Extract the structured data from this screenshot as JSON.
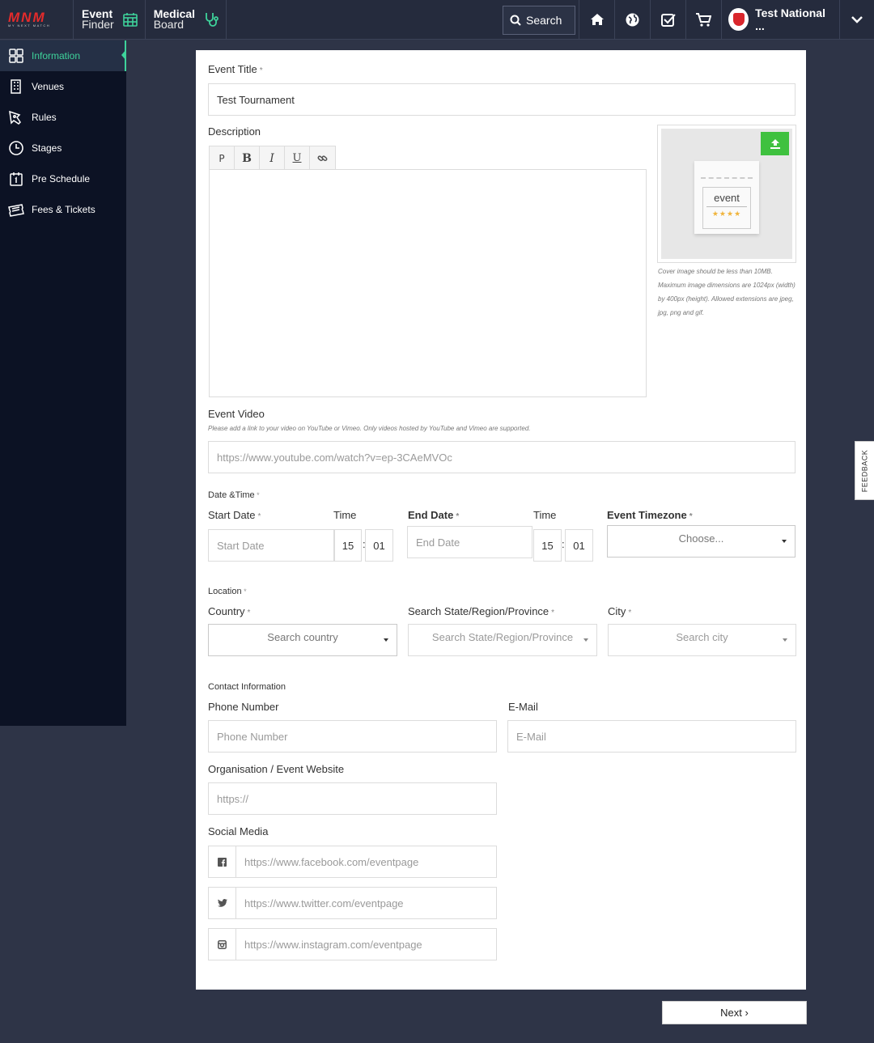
{
  "topbar": {
    "logo_text": "MNM",
    "logo_sub": "MY NEXT MATCH",
    "event_finder": {
      "line1": "Event",
      "line2": "Finder"
    },
    "medical_board": {
      "line1": "Medical",
      "line2": "Board"
    },
    "search_label": "Search",
    "user_name": "Test National ..."
  },
  "sidebar": {
    "items": [
      {
        "label": "Information"
      },
      {
        "label": "Venues"
      },
      {
        "label": "Rules"
      },
      {
        "label": "Stages"
      },
      {
        "label": "Pre Schedule"
      },
      {
        "label": "Fees & Tickets"
      }
    ]
  },
  "form": {
    "event_title": {
      "label": "Event Title",
      "value": "Test Tournament"
    },
    "description": {
      "label": "Description",
      "toolbar": [
        "P",
        "B",
        "I",
        "U"
      ]
    },
    "cover": {
      "ticket_text": "event",
      "hint": "Cover image should be less than 10MB. Maximum image dimensions are 1024px (width) by 400px (height). Allowed extensions are jpeg, jpg, png and gif."
    },
    "event_video": {
      "label": "Event Video",
      "hint": "Please add a link to your video on YouTube or Vimeo. Only videos hosted by YouTube and Vimeo are supported.",
      "placeholder": "https://www.youtube.com/watch?v=ep-3CAeMVOc"
    },
    "date_time": {
      "section": "Date &Time",
      "start_date_label": "Start Date",
      "start_date_placeholder": "Start Date",
      "time_label": "Time",
      "start_hour": "15",
      "start_min": "01",
      "end_date_label": "End Date",
      "end_date_placeholder": "End Date",
      "end_hour": "15",
      "end_min": "01",
      "timezone_label": "Event Timezone",
      "timezone_value": "Choose..."
    },
    "location": {
      "section": "Location",
      "country_label": "Country",
      "country_placeholder": "Search country",
      "state_label": "Search State/Region/Province",
      "state_placeholder": "Search State/Region/Province",
      "city_label": "City",
      "city_placeholder": "Search city"
    },
    "contact": {
      "section": "Contact Information",
      "phone_label": "Phone Number",
      "phone_placeholder": "Phone Number",
      "email_label": "E-Mail",
      "email_placeholder": "E-Mail",
      "website_label": "Organisation / Event Website",
      "website_placeholder": "https://"
    },
    "social": {
      "label": "Social Media",
      "facebook_placeholder": "https://www.facebook.com/eventpage",
      "twitter_placeholder": "https://www.twitter.com/eventpage",
      "instagram_placeholder": "https://www.instagram.com/eventpage"
    }
  },
  "next_label": "Next ›",
  "feedback_label": "FEEDBACK",
  "colors": {
    "accent": "#3ed39b",
    "upload": "#3fc13f",
    "brand": "#e52b2b"
  }
}
